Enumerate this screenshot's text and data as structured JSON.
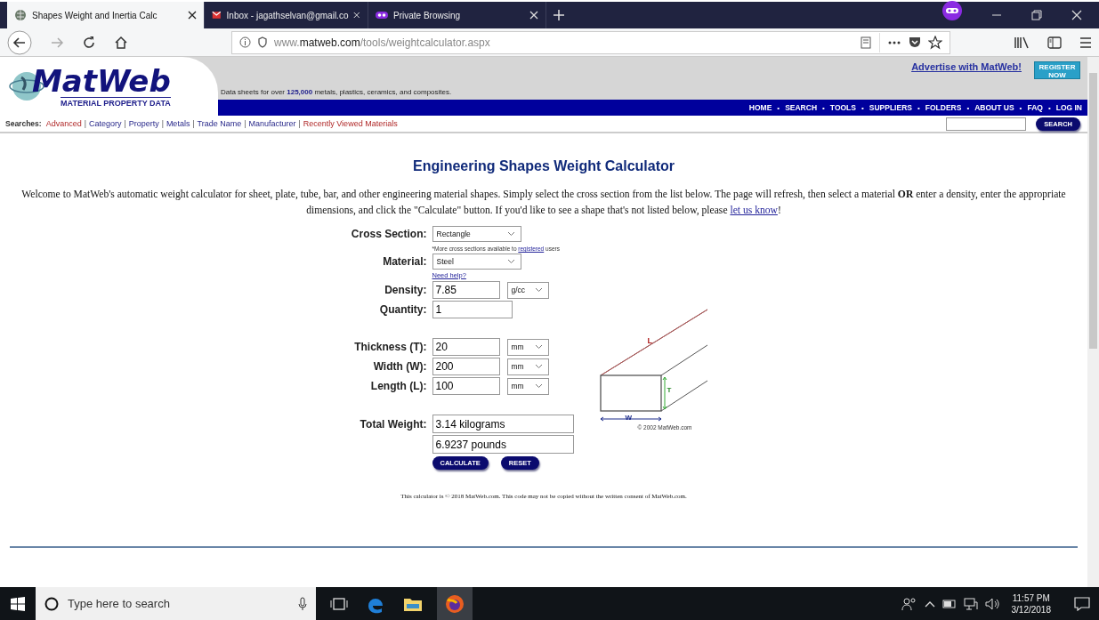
{
  "browser": {
    "tabs": [
      {
        "title": "Shapes Weight and Inertia Calc",
        "selected": true,
        "kind": "site"
      },
      {
        "title": "Inbox - jagathselvan@gmail.co",
        "selected": false,
        "kind": "mail"
      },
      {
        "title": "Private Browsing",
        "selected": false,
        "kind": "private"
      }
    ],
    "url": "www.**matweb.com**/tools/weightcalculator.aspx"
  },
  "header": {
    "logo_title": "MatWeb",
    "logo_subtitle": "MATERIAL PROPERTY DATA",
    "tagline": "Data sheets for over **125,000** metals, plastics, ceramics, and composites.",
    "advertise_link": "Advertise with MatWeb!",
    "register_button": "REGISTER NOW",
    "nav_separator": "•",
    "link_separator": "|",
    "nav": [
      "HOME",
      "SEARCH",
      "TOOLS",
      "SUPPLIERS",
      "FOLDERS",
      "ABOUT US",
      "FAQ",
      "LOG IN"
    ],
    "searches_label": "Searches:",
    "search_links": [
      {
        "label": "Advanced",
        "kind": "featured"
      },
      {
        "label": "Category",
        "kind": "plain"
      },
      {
        "label": "Property",
        "kind": "plain"
      },
      {
        "label": "Metals",
        "kind": "plain"
      },
      {
        "label": "Trade Name",
        "kind": "plain"
      },
      {
        "label": "Manufacturer",
        "kind": "plain"
      },
      {
        "label": "Recently Viewed Materials",
        "kind": "featured"
      }
    ],
    "search_button": "SEARCH"
  },
  "title": "Engineering Shapes Weight Calculator",
  "intro": {
    "text": "Welcome to MatWeb's automatic weight calculator for sheet, plate, tube, bar, and other engineering material shapes. Simply select the cross section from the list below. The page will refresh, then select a material **OR** enter a density, enter the appropriate dimensions, and click the \"Calculate\" button. If you'd like to see a shape that's not listed below, please ",
    "link": "let us know",
    "after": "!"
  },
  "form": [
    {
      "kind": "select",
      "label": "Cross Section:",
      "value": "Rectangle"
    },
    {
      "kind": "note",
      "text": "*More cross sections available to ",
      "link": "registered",
      "after": " users"
    },
    {
      "kind": "select",
      "label": "Material:",
      "value": "Steel"
    },
    {
      "kind": "link",
      "text": "Need help?"
    },
    {
      "kind": "input",
      "label": "Density:",
      "value": "7.85",
      "unit": "g/cc"
    },
    {
      "kind": "input",
      "label": "Quantity:",
      "value": "1"
    },
    {
      "kind": "gap"
    },
    {
      "kind": "input",
      "label": "Thickness (T):",
      "value": "20",
      "unit": "mm"
    },
    {
      "kind": "input",
      "label": "Width (W):",
      "value": "200",
      "unit": "mm"
    },
    {
      "kind": "input",
      "label": "Length (L):",
      "value": "100",
      "unit": "mm"
    },
    {
      "kind": "gap"
    },
    {
      "kind": "output",
      "label": "Total Weight:",
      "value": "3.14 kilograms"
    },
    {
      "kind": "output",
      "value": "6.9237 pounds"
    },
    {
      "kind": "buttons",
      "buttons": [
        "CALCULATE",
        "RESET"
      ]
    }
  ],
  "diagram": {
    "length_label": "L",
    "thickness_label": "T",
    "width_label": "W",
    "credit": "© 2002 MatWeb.com"
  },
  "footer": "This calculator is © 2018 MatWeb.com.  This code may not be copied without the written consent of MatWeb.com.",
  "taskbar": {
    "search_placeholder": "Type here to search",
    "time": "11:57 PM",
    "date": "3/12/2018"
  }
}
